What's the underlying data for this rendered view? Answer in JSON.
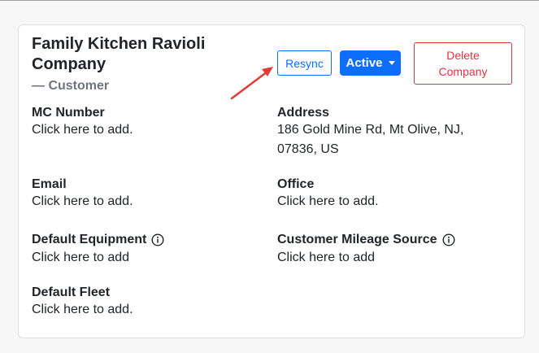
{
  "company": {
    "name": "Family Kitchen Ravioli Company",
    "type": "— Customer"
  },
  "actions": {
    "resync_label": "Resync",
    "status_label": "Active",
    "delete_label": "Delete Company"
  },
  "fields": {
    "mc_number": {
      "label": "MC Number",
      "value": "Click here to add."
    },
    "address": {
      "label": "Address",
      "value": "186 Gold Mine Rd, Mt Olive, NJ, 07836, US"
    },
    "email": {
      "label": "Email",
      "value": "Click here to add."
    },
    "office": {
      "label": "Office",
      "value": "Click here to add."
    },
    "default_equipment": {
      "label": "Default Equipment",
      "value": "Click here to add"
    },
    "customer_mileage_source": {
      "label": "Customer Mileage Source",
      "value": "Click here to add"
    },
    "default_fleet": {
      "label": "Default Fleet",
      "value": "Click here to add."
    }
  },
  "icons": {
    "info": "info-circle-icon",
    "arrow": "red-arrow-annotation"
  },
  "colors": {
    "primary": "#0d6efd",
    "danger": "#dc3545",
    "muted": "#6c757d",
    "annotation": "#e53935"
  }
}
